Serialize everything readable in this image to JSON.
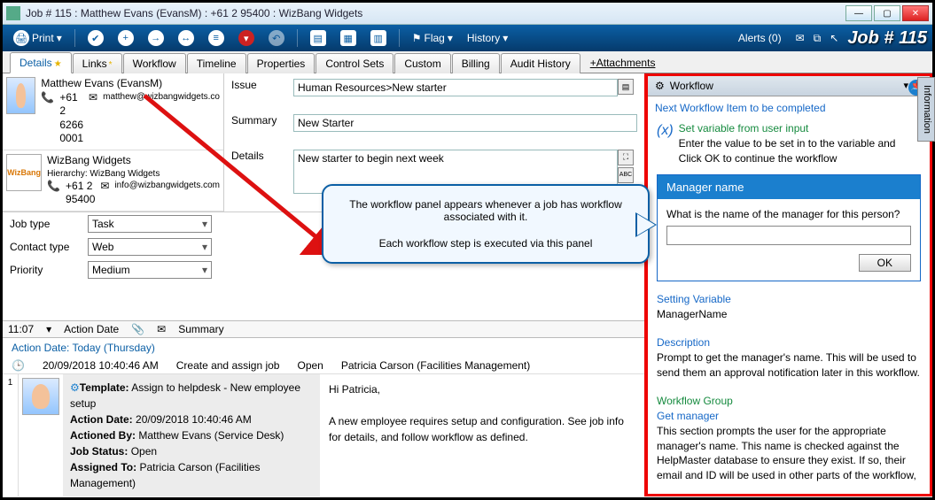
{
  "window": {
    "title": "Job # 115 : Matthew Evans (EvansM) : +61 2 95400 : WizBang Widgets",
    "job_number_display": "Job # 115"
  },
  "toolbar": {
    "print": "Print",
    "flag": "Flag",
    "history": "History",
    "alerts": "Alerts (0)"
  },
  "tabs": [
    "Details",
    "Links",
    "Workflow",
    "Timeline",
    "Properties",
    "Control Sets",
    "Custom",
    "Billing",
    "Audit History"
  ],
  "tabs_active": 0,
  "attachments_label": "+Attachments",
  "contact": {
    "person_name": "Matthew Evans (EvansM)",
    "person_phone": "+61 2 6266 0001",
    "person_email": "matthew@wizbangwidgets.co",
    "company_name": "WizBang Widgets",
    "company_hierarchy": "Hierarchy: WizBang Widgets",
    "company_phone": "+61 2 95400",
    "company_email": "info@wizbangwidgets.com"
  },
  "issue": {
    "issue_label": "Issue",
    "issue_value": "Human Resources>New starter",
    "summary_label": "Summary",
    "summary_value": "New Starter",
    "details_label": "Details",
    "details_value": "New starter to begin next week"
  },
  "fields": {
    "jobtype_label": "Job type",
    "jobtype_value": "Task",
    "contacttype_label": "Contact type",
    "contacttype_value": "Web",
    "priority_label": "Priority",
    "priority_value": "Medium"
  },
  "callout": {
    "line1": "The workflow panel appears whenever a job has workflow associated with it.",
    "line2": "Each workflow step is executed via this panel"
  },
  "actions": {
    "header_time": "11:07",
    "col_date": "Action Date",
    "col_summary": "Summary",
    "today_line": "Action Date:    Today    (Thursday)",
    "row_time": "20/09/2018 10:40:46 AM",
    "row_action": "Create and assign job",
    "row_status": "Open",
    "row_person": "Patricia Carson (Facilities Management)",
    "template_label": "Template:",
    "template_value": "Assign to helpdesk - New employee setup",
    "actiondate_label": "Action Date:",
    "actiondate_value": "20/09/2018 10:40:46 AM",
    "actionedby_label": "Actioned By:",
    "actionedby_value": "Matthew Evans (Service Desk)",
    "jobstatus_label": "Job Status:",
    "jobstatus_value": "Open",
    "assignedto_label": "Assigned To:",
    "assignedto_value": "Patricia Carson (Facilities Management)",
    "body": "Hi Patricia,\n\nA new employee requires setup and configuration.  See job info for details, and follow workflow as defined."
  },
  "workflow": {
    "panel_title": "Workflow",
    "next_title": "Next Workflow Item to be completed",
    "step_title": "Set variable from user input",
    "step_desc": "Enter the value to be set in to the variable and Click OK to continue the workflow",
    "card_title": "Manager name",
    "card_question": "What is the name of the manager for this person?",
    "ok_label": "OK",
    "setting_var_h": "Setting Variable",
    "setting_var_v": "ManagerName",
    "desc_h": "Description",
    "desc_v": "Prompt to get the manager's name. This will be used to send them an approval notification later in this workflow.",
    "group_h": "Workflow Group",
    "group_v": "Get manager",
    "group_desc": "This section prompts the user for the appropriate manager's name. This name is checked against the HelpMaster database to ensure they exist. If so, their email and ID will be used in other parts of the workflow,"
  },
  "info_tab": "Information"
}
